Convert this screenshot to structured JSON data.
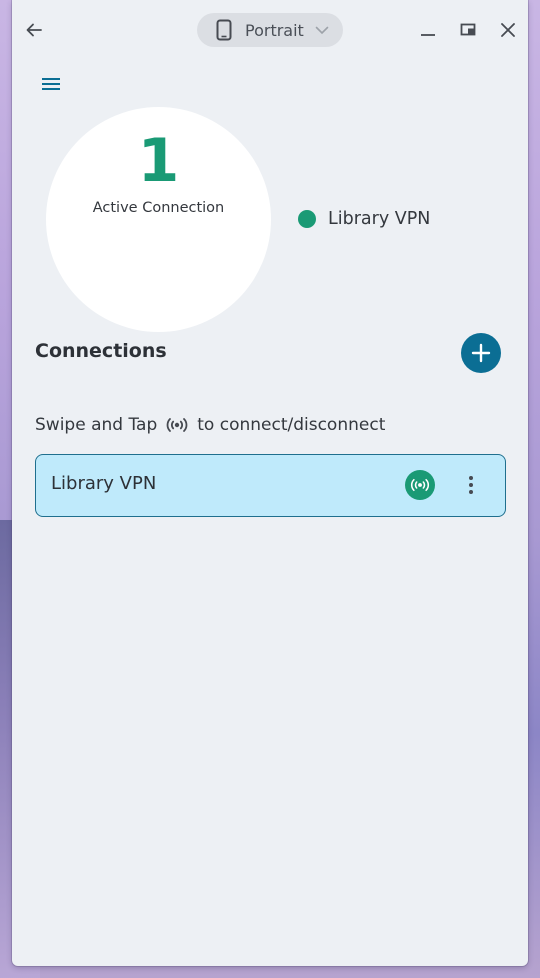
{
  "titlebar": {
    "back_icon": "arrow-left-icon",
    "orientation_label": "Portrait",
    "orientation_icon": "phone-icon",
    "minimize_icon": "minimize-icon",
    "restore_icon": "restore-icon",
    "close_icon": "close-icon"
  },
  "app": {
    "menu_icon": "hamburger-menu-icon",
    "active_count": "1",
    "active_label": "Active Connection",
    "legend": [
      {
        "label": "Library VPN",
        "color": "#1a9a75"
      }
    ],
    "section_title": "Connections",
    "add_icon": "plus-icon",
    "hint_before": "Swipe and Tap",
    "hint_icon": "broadcast-icon",
    "hint_after": "to connect/disconnect",
    "connections": [
      {
        "name": "Library VPN",
        "status": "connected",
        "toggle_icon": "broadcast-icon",
        "menu_icon": "more-vertical-icon"
      }
    ]
  },
  "colors": {
    "accent_green": "#1a9a75",
    "accent_blue": "#0b6e94",
    "card_bg": "#bfeafb",
    "window_bg": "#edf0f4"
  }
}
